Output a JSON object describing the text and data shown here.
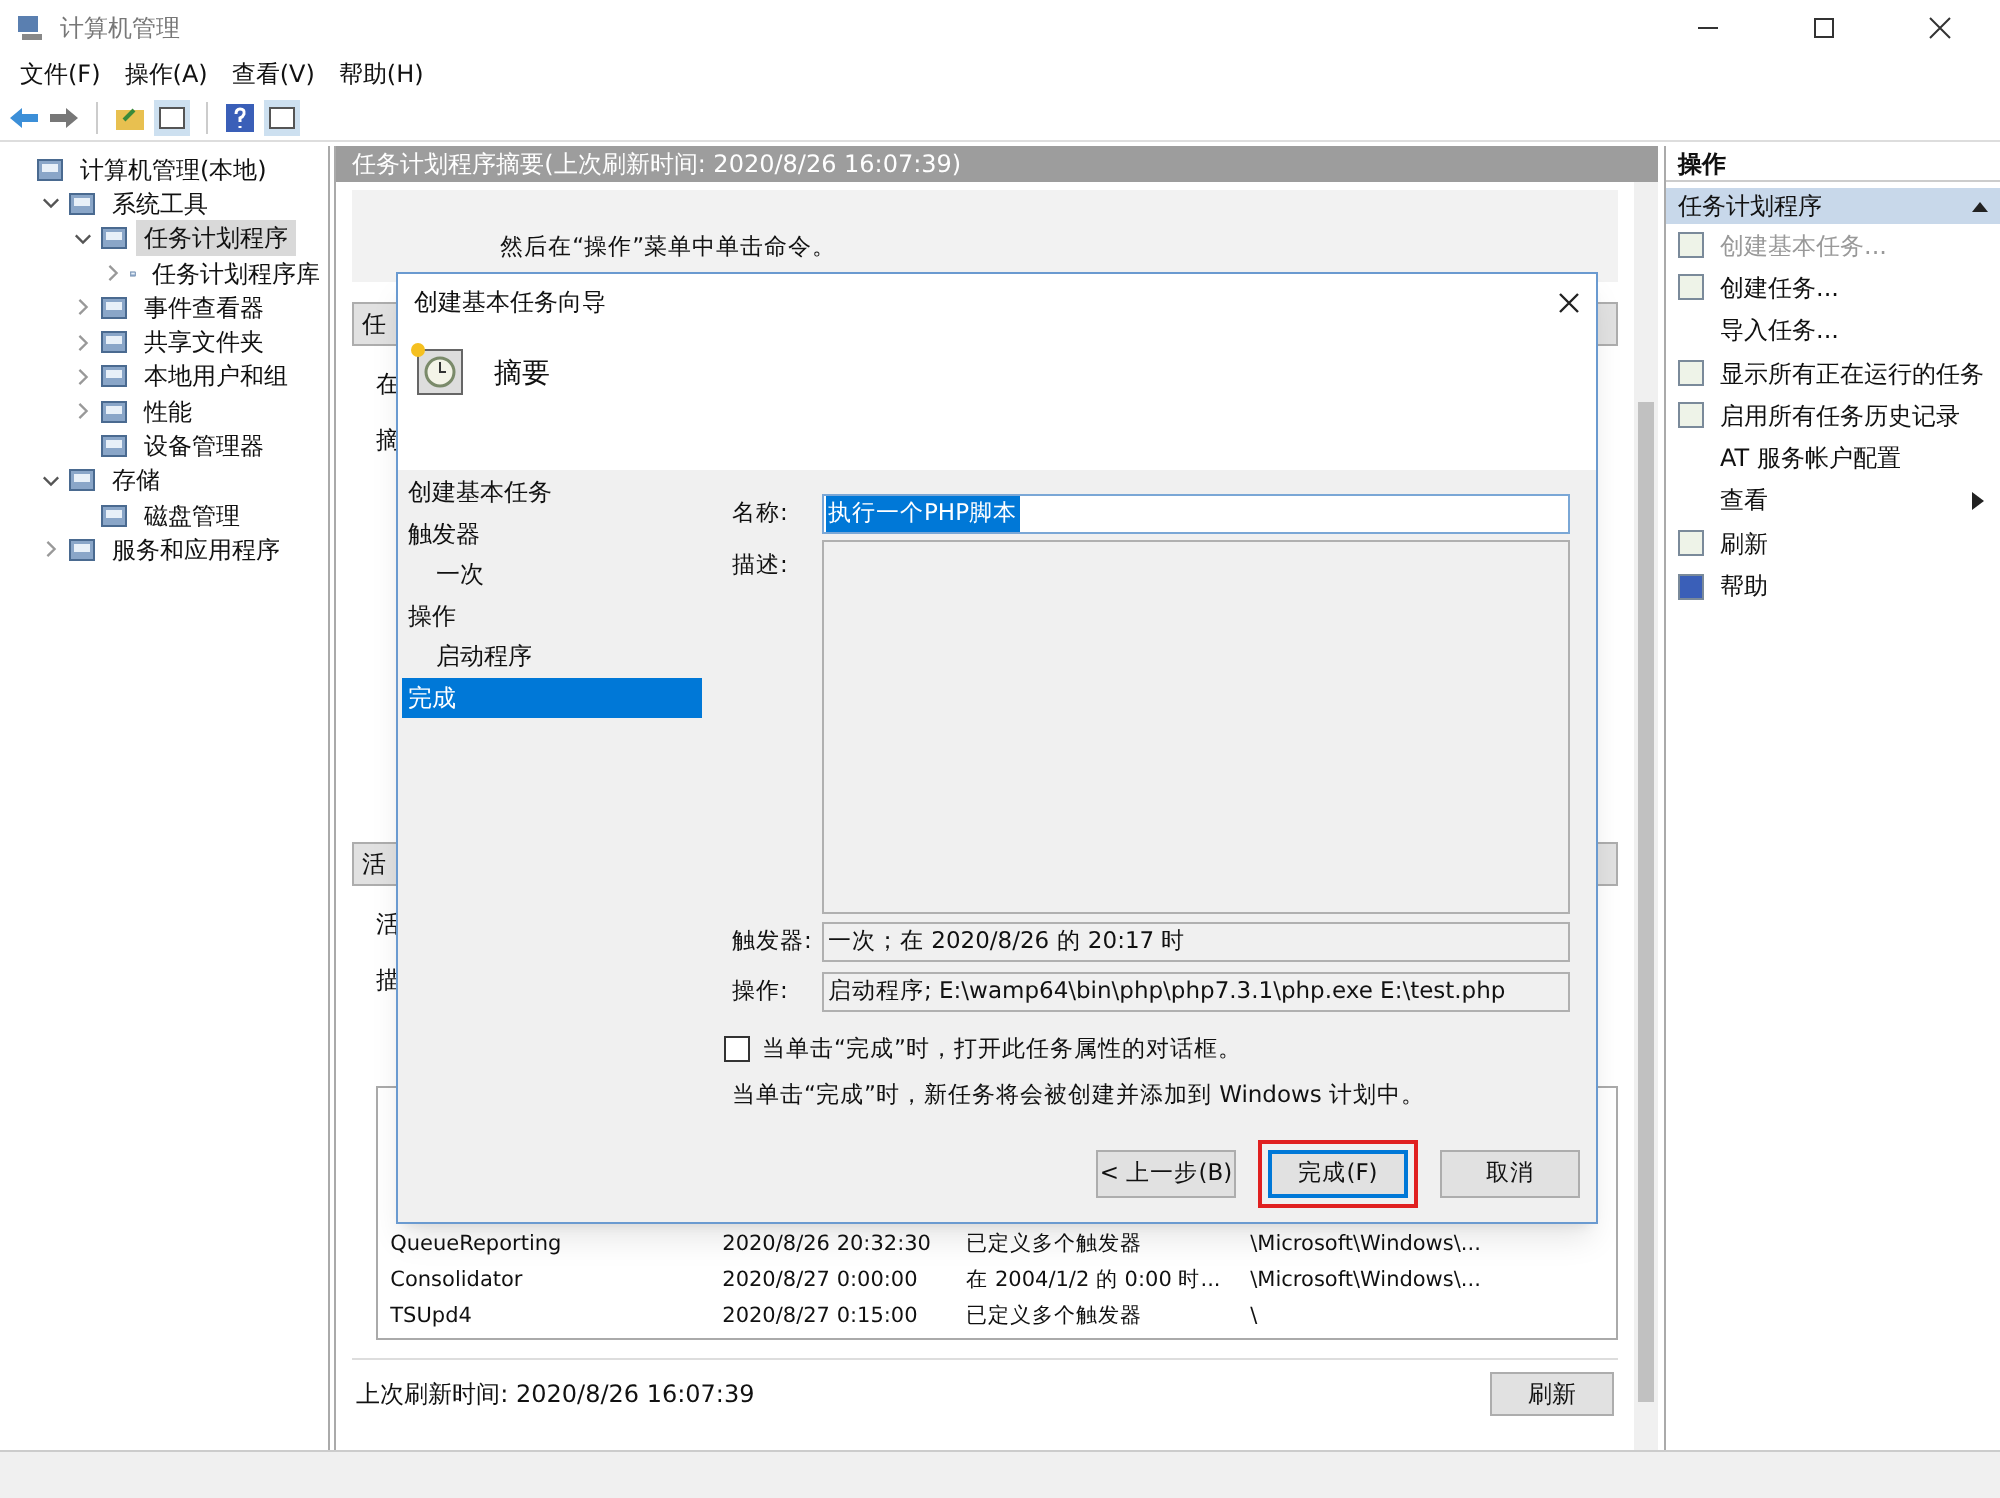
{
  "window": {
    "title": "计算机管理"
  },
  "menu": [
    "文件(F)",
    "操作(A)",
    "查看(V)",
    "帮助(H)"
  ],
  "tree": [
    {
      "label": "计算机管理(本地)",
      "selected": false,
      "children": [
        {
          "label": "系统工具",
          "selected": false,
          "expanded": true,
          "children": [
            {
              "label": "任务计划程序",
              "selected": true,
              "expanded": true,
              "children": [
                {
                  "label": "任务计划程序库",
                  "selected": false,
                  "expanded": false
                }
              ]
            },
            {
              "label": "事件查看器",
              "selected": false,
              "expanded": false
            },
            {
              "label": "共享文件夹",
              "selected": false,
              "expanded": false
            },
            {
              "label": "本地用户和组",
              "selected": false,
              "expanded": false
            },
            {
              "label": "性能",
              "selected": false,
              "expanded": false
            },
            {
              "label": "设备管理器",
              "selected": false
            }
          ]
        },
        {
          "label": "存储",
          "selected": false,
          "expanded": true,
          "children": [
            {
              "label": "磁盘管理",
              "selected": false
            }
          ]
        },
        {
          "label": "服务和应用程序",
          "selected": false,
          "expanded": false
        }
      ]
    }
  ],
  "center": {
    "header": "任务计划程序摘要(上次刷新时间: 2020/8/26 16:07:39)",
    "description": "然后在“操作”菜单中单击命令。",
    "sections": [
      {
        "label": "任",
        "lines": [
          "在",
          "摘"
        ]
      },
      {
        "label": "活",
        "lines": [
          "活",
          "描"
        ]
      }
    ],
    "rows": [
      {
        "name": "QueueReporting",
        "time": "2020/8/26 20:32:30",
        "trigger": "已定义多个触发器",
        "path": "\\Microsoft\\Windows\\..."
      },
      {
        "name": "Consolidator",
        "time": "2020/8/27 0:00:00",
        "trigger": "在 2004/1/2 的 0:00 时...",
        "path": "\\Microsoft\\Windows\\..."
      },
      {
        "name": "TSUpd4",
        "time": "2020/8/27 0:15:00",
        "trigger": "已定义多个触发器",
        "path": "\\"
      }
    ],
    "footer": "上次刷新时间: 2020/8/26 16:07:39",
    "refresh_button": "刷新"
  },
  "actions": {
    "header": "操作",
    "section": "任务计划程序",
    "items": [
      {
        "label": "创建基本任务...",
        "disabled": true,
        "submenu": false
      },
      {
        "label": "创建任务...",
        "disabled": false,
        "submenu": false
      },
      {
        "label": "导入任务...",
        "disabled": false,
        "submenu": false
      },
      {
        "label": "显示所有正在运行的任务",
        "disabled": false,
        "submenu": false
      },
      {
        "label": "启用所有任务历史记录",
        "disabled": false,
        "submenu": false
      },
      {
        "label": "AT 服务帐户配置",
        "disabled": false,
        "submenu": false
      },
      {
        "label": "查看",
        "disabled": false,
        "submenu": true
      },
      {
        "label": "刷新",
        "disabled": false,
        "submenu": false
      },
      {
        "label": "帮助",
        "disabled": false,
        "submenu": false
      }
    ]
  },
  "dialog": {
    "title": "创建基本任务向导",
    "heading": "摘要",
    "steps": [
      {
        "label": "创建基本任务",
        "selected": false
      },
      {
        "label": "触发器",
        "selected": false,
        "children": [
          {
            "label": "一次",
            "selected": false
          }
        ]
      },
      {
        "label": "操作",
        "selected": false,
        "children": [
          {
            "label": "启动程序",
            "selected": false
          }
        ]
      },
      {
        "label": "完成",
        "selected": true
      }
    ],
    "name_label": "名称:",
    "name_value": "执行一个PHP脚本",
    "description_label": "描述:",
    "trigger_label": "触发器:",
    "trigger_value": "一次；在 2020/8/26 的 20:17 时",
    "action_label": "操作:",
    "action_value": "启动程序; E:\\wamp64\\bin\\php\\php7.3.1\\php.exe E:\\test.php",
    "checkbox": {
      "label": "当单击“完成”时，打开此任务属性的对话框。",
      "checked": false
    },
    "note": "当单击“完成”时，新任务将会被创建并添加到 Windows 计划中。",
    "buttons": [
      {
        "label": "< 上一步(B)",
        "focused": false,
        "highlighted": false
      },
      {
        "label": "完成(F)",
        "focused": true,
        "highlighted": true
      },
      {
        "label": "取消",
        "focused": false,
        "highlighted": false
      }
    ]
  }
}
